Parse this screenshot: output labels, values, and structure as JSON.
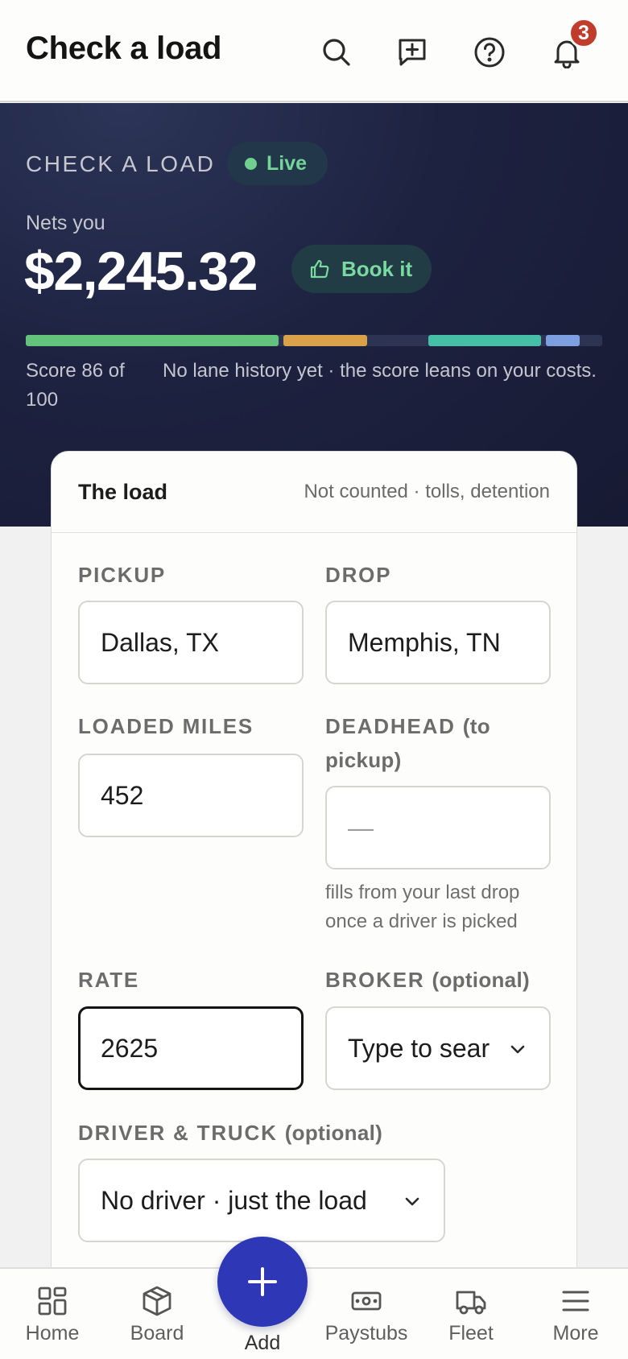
{
  "header": {
    "title": "Check a load",
    "notification_count": "3",
    "icons": [
      "search-icon",
      "new-message-icon",
      "help-icon",
      "bell-icon"
    ]
  },
  "hero": {
    "label": "CHECK A LOAD",
    "live_label": "Live",
    "nets_label": "Nets you",
    "amount": "$2,245.32",
    "book_label": "Book it",
    "score_text": "Score 86 of 100",
    "score_value": 86,
    "score_max": 100,
    "score_note": "No lane history yet · the score leans on your costs.",
    "colors": {
      "accent_green": "#63c27b",
      "accent_amber": "#d9a24a",
      "accent_teal": "#47bfa6",
      "accent_blue": "#7d9fe0",
      "track": "#2d3352"
    }
  },
  "card": {
    "title": "The load",
    "subtitle": "Not counted · tolls, detention",
    "pickup": {
      "label": "PICKUP",
      "value": "Dallas, TX"
    },
    "drop": {
      "label": "DROP",
      "value": "Memphis, TN"
    },
    "loaded_miles": {
      "label": "LOADED MILES",
      "value": "452"
    },
    "deadhead": {
      "label": "DEADHEAD",
      "label_suffix": "(to pickup)",
      "value": "—",
      "helper": "fills from your last drop once a driver is picked"
    },
    "rate": {
      "label": "RATE",
      "value": "2625"
    },
    "broker": {
      "label": "BROKER",
      "label_suffix": "(optional)",
      "placeholder": "Type to sear"
    },
    "driver_truck": {
      "label": "DRIVER & TRUCK",
      "label_suffix": "(optional)",
      "value": "No driver · just the load"
    }
  },
  "bottom_nav": {
    "home": "Home",
    "board": "Board",
    "add": "Add",
    "paystubs": "Paystubs",
    "fleet": "Fleet",
    "more": "More"
  },
  "colors": {
    "fab": "#2e37b6",
    "badge": "#c13c2b",
    "hero_bg": "#1d2240"
  }
}
